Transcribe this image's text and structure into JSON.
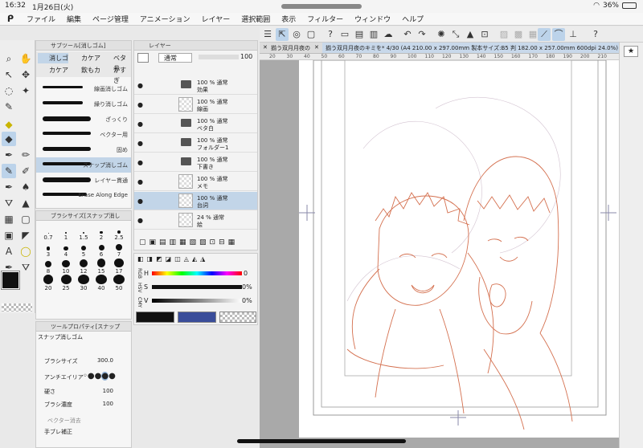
{
  "status": {
    "time": "16:32",
    "date": "1月26日(火)",
    "battery": "36%"
  },
  "menu": [
    "ファイル",
    "編集",
    "ページ管理",
    "アニメーション",
    "レイヤー",
    "選択範囲",
    "表示",
    "フィルター",
    "ウィンドウ",
    "ヘルプ"
  ],
  "subtool": {
    "title": "サブツール[消しゴム]",
    "tabs": [
      "消しゴ",
      "カケア",
      "ベタ参",
      "カケア",
      "飲もカ",
      "かすぎ"
    ],
    "items": [
      "線画消しゴム",
      "繰り消しゴム",
      "ざっくり",
      "ベクター用",
      "固め",
      "スナップ消しゴム",
      "レイヤー貫通",
      "Erase Along Edge"
    ]
  },
  "brushsize": {
    "title": "ブラシサイズ[スナップ消し",
    "values": [
      "0.7",
      "1",
      "1.5",
      "2",
      "2.5",
      "3",
      "4",
      "5",
      "6",
      "7",
      "8",
      "10",
      "12",
      "15",
      "17",
      "20",
      "25",
      "30",
      "40",
      "50"
    ]
  },
  "toolprop": {
    "title": "ツールプロパティ[スナップ",
    "name": "スナップ消しゴム",
    "brush_size_label": "ブラシサイズ",
    "brush_size": "300.0",
    "antialias_label": "アンチエイリア",
    "hardness_label": "硬さ",
    "hardness": "100",
    "density_label": "ブラシ濃度",
    "density": "100",
    "vector_label": "ベクター消去",
    "stabilization_label": "手ブレ補正"
  },
  "layers": {
    "title": "レイヤー",
    "blend": "通常",
    "opacity": "100",
    "rows": [
      {
        "a": "100 % 通常",
        "b": "効果",
        "type": "folder"
      },
      {
        "a": "100 % 通常",
        "b": "線画",
        "type": "layer"
      },
      {
        "a": "100 % 通常",
        "b": "ベタ白",
        "type": "folder"
      },
      {
        "a": "100 % 通常",
        "b": "フォルダー1",
        "type": "folder"
      },
      {
        "a": "100 % 通常",
        "b": "下書き",
        "type": "folder"
      },
      {
        "a": "100 % 通常",
        "b": "メモ",
        "type": "layer"
      },
      {
        "a": "100 % 通常",
        "b": "台詞",
        "type": "layer",
        "selected": true
      },
      {
        "a": "24 % 通常",
        "b": "絵",
        "type": "layer"
      }
    ]
  },
  "color": {
    "labels": [
      "RGB",
      "HSV",
      "CMY"
    ],
    "h": "0",
    "s": "0%",
    "v": "0%",
    "main": "#111111",
    "sub": "#3a4d9a"
  },
  "document": {
    "tab": "揃う双月月夜の",
    "title": "揃う双月月夜のキミを* 4/30 (A4 210.00 x 297.00mm 製本サイズ:B5 判 182.00 x 257.00mm 600dpi 24.0%)",
    "ruler": [
      "20",
      "30",
      "40",
      "50",
      "60",
      "70",
      "80",
      "90",
      "100",
      "110",
      "120",
      "130",
      "140",
      "150",
      "160",
      "170",
      "180",
      "190",
      "200",
      "210"
    ]
  }
}
